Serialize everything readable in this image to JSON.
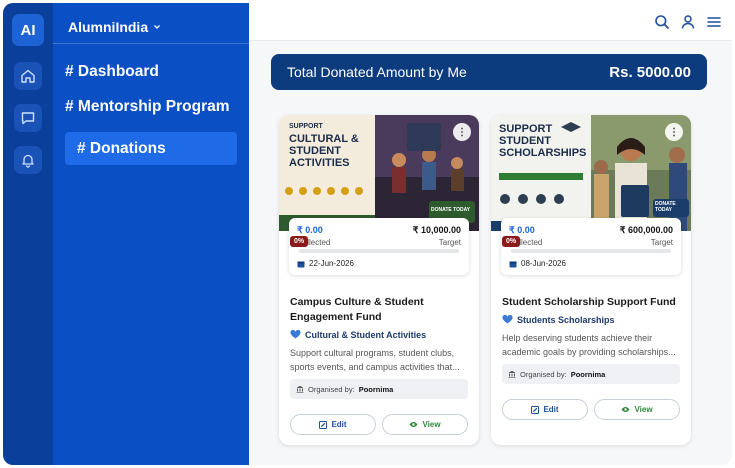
{
  "app": {
    "logo": "AI",
    "org_name": "AlumniIndia"
  },
  "sidebar": {
    "items": [
      {
        "label": "# Dashboard"
      },
      {
        "label": "# Mentorship Program"
      },
      {
        "label": "# Donations",
        "active": true
      }
    ]
  },
  "rail": {
    "icons": [
      "home-icon",
      "chat-icon",
      "bell-icon"
    ]
  },
  "topbar": {
    "icons": [
      "search-icon",
      "user-icon",
      "menu-icon"
    ]
  },
  "summary": {
    "label": "Total Donated Amount by Me",
    "amount": "Rs. 5000.00"
  },
  "cards": [
    {
      "banner": {
        "line1": "SUPPORT",
        "line2": "CULTURAL &",
        "line3": "STUDENT",
        "line4": "ACTIVITIES",
        "cta": "DONATE TODAY",
        "accent": "#f4c430"
      },
      "collected_amount": "₹ 0.00",
      "collected_label": "Collected",
      "target_amount": "₹ 10,000.00",
      "target_label": "Target",
      "percent": "0%",
      "progress": 0,
      "date": "22-Jun-2026",
      "title": "Campus Culture & Student Engagement Fund",
      "category": "Cultural & Student Activities",
      "description": "Support cultural programs, student clubs, sports events, and campus activities that...",
      "organised_label": "Organised by:",
      "organiser": "Poornima",
      "edit_label": "Edit",
      "view_label": "View"
    },
    {
      "banner": {
        "line1": "SUPPORT",
        "line2": "STUDENT",
        "line3": "SCHOLARSHIPS",
        "cta": "DONATE TODAY",
        "accent": "#2e7d32"
      },
      "collected_amount": "₹ 0.00",
      "collected_label": "Collected",
      "target_amount": "₹ 600,000.00",
      "target_label": "Target",
      "percent": "0%",
      "progress": 0,
      "date": "08-Jun-2026",
      "title": "Student Scholarship Support Fund",
      "category": "Students Scholarships",
      "description": "Help deserving students achieve their academic goals by providing scholarships...",
      "organised_label": "Organised by:",
      "organiser": "Poornima",
      "edit_label": "Edit",
      "view_label": "View"
    }
  ],
  "colors": {
    "sidebar": "#0a4fc4",
    "rail": "#0b3f9c",
    "summary": "#0c3b7e",
    "progress": "#8b1a1a"
  }
}
